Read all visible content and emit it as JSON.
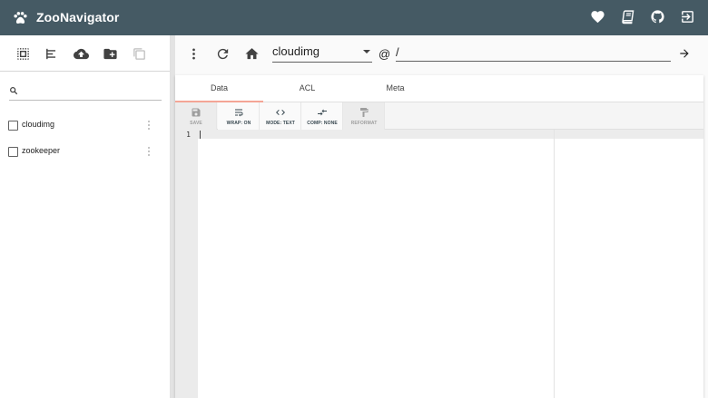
{
  "app": {
    "title": "ZooNavigator"
  },
  "colors": {
    "topbar": "#455a64",
    "active_tab_indicator": "#f4a596"
  },
  "header_actions": [
    "heart-icon",
    "book-icon",
    "github-icon",
    "logout-icon"
  ],
  "left_toolbar": [
    "select-all-icon",
    "sort-icon",
    "cloud-upload-icon",
    "new-folder-icon",
    "copy-icon"
  ],
  "search": {
    "placeholder": "",
    "value": ""
  },
  "tree": {
    "nodes": [
      {
        "label": "cloudimg"
      },
      {
        "label": "zookeeper"
      }
    ]
  },
  "path_bar": {
    "connection": "cloudimg",
    "at": "@",
    "path": "/"
  },
  "tabs": [
    {
      "label": "Data",
      "active": true
    },
    {
      "label": "ACL",
      "active": false
    },
    {
      "label": "Meta",
      "active": false
    }
  ],
  "editor_toolbar": {
    "save": "SAVE",
    "wrap": "WRAP: ON",
    "mode": "MODE: TEXT",
    "comp": "COMP: NONE",
    "reformat": "REFORMAT"
  },
  "editor": {
    "line_numbers": [
      "1"
    ],
    "content": ""
  }
}
